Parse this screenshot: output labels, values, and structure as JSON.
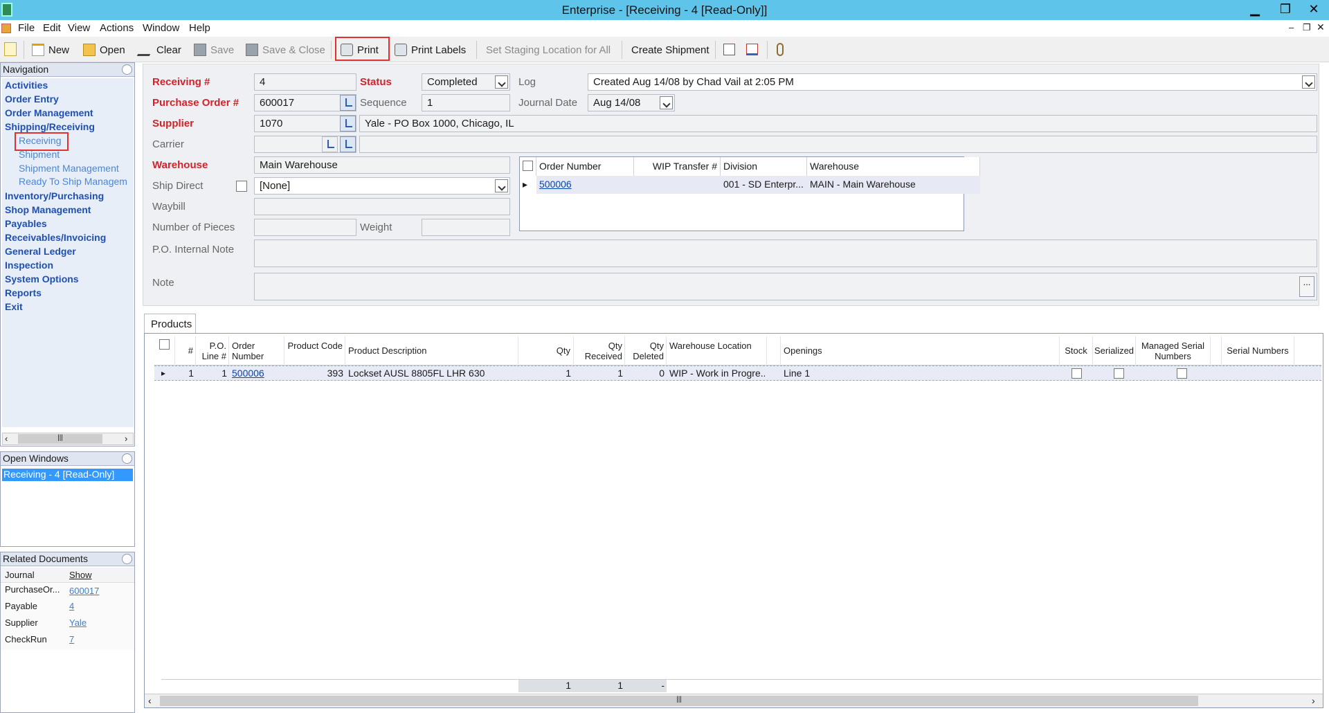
{
  "window": {
    "title": "Enterprise - [Receiving - 4 [Read-Only]]"
  },
  "menu": [
    "File",
    "Edit",
    "View",
    "Actions",
    "Window",
    "Help"
  ],
  "toolbar": {
    "new": "New",
    "open": "Open",
    "clear": "Clear",
    "save": "Save",
    "save_close": "Save & Close",
    "print": "Print",
    "print_labels": "Print Labels",
    "set_staging": "Set Staging Location for All",
    "create_shipment": "Create Shipment"
  },
  "navigation": {
    "title": "Navigation",
    "items": [
      "Activities",
      "Order Entry",
      "Order Management",
      "Shipping/Receiving",
      "Inventory/Purchasing",
      "Shop Management",
      "Payables",
      "Receivables/Invoicing",
      "General Ledger",
      "Inspection",
      "System Options",
      "Reports",
      "Exit"
    ],
    "sub_items": [
      "Receiving",
      "Shipment",
      "Shipment Management",
      "Ready To Ship Managem"
    ]
  },
  "open_windows": {
    "title": "Open Windows",
    "items": [
      "Receiving - 4 [Read-Only]"
    ]
  },
  "related_documents": {
    "title": "Related Documents",
    "header": {
      "col1": "Journal",
      "col2": "Show"
    },
    "rows": [
      {
        "journal": "PurchaseOr...",
        "show": "600017"
      },
      {
        "journal": "Payable",
        "show": "4"
      },
      {
        "journal": "Supplier",
        "show": "Yale"
      },
      {
        "journal": "CheckRun",
        "show": "7"
      }
    ]
  },
  "form": {
    "receiving_label": "Receiving #",
    "receiving_value": "4",
    "status_label": "Status",
    "status_value": "Completed",
    "log_label": "Log",
    "log_value": "Created Aug 14/08 by Chad Vail at 2:05 PM",
    "po_label": "Purchase Order #",
    "po_value": "600017",
    "sequence_label": "Sequence",
    "sequence_value": "1",
    "journal_date_label": "Journal Date",
    "journal_date_value": "Aug 14/08",
    "supplier_label": "Supplier",
    "supplier_value": "1070",
    "supplier_address": "Yale - PO Box 1000, Chicago, IL",
    "carrier_label": "Carrier",
    "warehouse_label": "Warehouse",
    "warehouse_value": "Main Warehouse",
    "ship_direct_label": "Ship Direct",
    "ship_direct_value": "[None]",
    "waybill_label": "Waybill",
    "pieces_label": "Number of Pieces",
    "weight_label": "Weight",
    "po_note_label": "P.O. Internal Note",
    "note_label": "Note",
    "note_button": "..."
  },
  "order_grid": {
    "headers": [
      "Order Number",
      "WIP Transfer #",
      "Division",
      "Warehouse"
    ],
    "rows": [
      {
        "order_number": "500006",
        "wip": "",
        "division": "001 - SD Enterpr...",
        "warehouse": "MAIN - Main Warehouse"
      }
    ]
  },
  "tabs": {
    "products": "Products"
  },
  "products": {
    "headers": {
      "num": "#",
      "po_line": "P.O. Line #",
      "order_number": "Order Number",
      "product_code": "Product Code",
      "description": "Product Description",
      "qty": "Qty",
      "qty_received": "Qty Received",
      "qty_deleted": "Qty Deleted",
      "wh_location": "Warehouse Location",
      "openings": "Openings",
      "stock": "Stock",
      "serialized": "Serialized",
      "managed_serial": "Managed Serial Numbers",
      "serial_numbers": "Serial Numbers"
    },
    "rows": [
      {
        "num": "1",
        "po_line": "1",
        "order_number": "500006",
        "product_code": "393",
        "description": "Lockset AUSL 8805FL LHR 630",
        "qty": "1",
        "qty_received": "1",
        "qty_deleted": "0",
        "wh_location": "WIP - Work in Progre...",
        "openings": "Line 1"
      }
    ],
    "totals": {
      "qty": "1",
      "qty_received": "1",
      "qty_deleted": "-"
    }
  }
}
